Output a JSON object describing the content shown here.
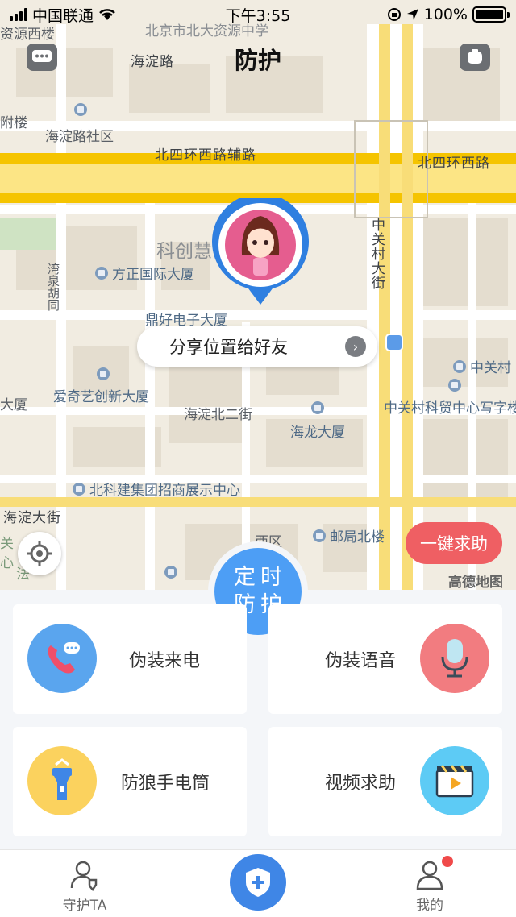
{
  "status_bar": {
    "carrier": "中国联通",
    "time": "下午3:55",
    "battery": "100%"
  },
  "header": {
    "title": "防护"
  },
  "map": {
    "labels": {
      "top_school": "北京市北大资源中学",
      "road_haidian": "海淀路",
      "school_left": "资源西楼",
      "fulou": "附楼",
      "haidian_community": "海淀路社区",
      "beisihuan_fu": "北四环西路辅路",
      "beisihuan": "北四环西路",
      "kechuanghui": "科创慧",
      "zhongguancun_st": "中关村大街",
      "fangzheng": "方正国际大厦",
      "wanquan": "湾泉胡同",
      "dinghao": "鼎好电子大厦",
      "zhongguancun_right": "中关村",
      "daxia_left": "大厦",
      "iqiyi": "爱奇艺创新大厦",
      "zhongguancun_keimao": "中关村科贸中心写字楼",
      "haidian_bei2": "海淀北二街",
      "hailong": "海龙大厦",
      "beike": "北科建集团招商展示中心",
      "haidian_dajie": "海淀大街",
      "xiqu": "西区",
      "youju": "邮局北楼",
      "guan": "关",
      "xin": "心",
      "fa": "法"
    },
    "share_label": "分享位置给好友",
    "sos_label": "一键求助",
    "logo": "高德地图",
    "timer_line1": "定时",
    "timer_line2": "防护"
  },
  "features": [
    {
      "label": "伪装来电",
      "icon": "phone-call-icon",
      "color": "#5aa5ee"
    },
    {
      "label": "伪装语音",
      "icon": "microphone-icon",
      "color": "#f27c80"
    },
    {
      "label": "防狼手电筒",
      "icon": "flashlight-icon",
      "color": "#fbd25e"
    },
    {
      "label": "视频求助",
      "icon": "video-icon",
      "color": "#5dcbf5"
    }
  ],
  "tabbar": {
    "left": "守护TA",
    "right": "我的"
  },
  "colors": {
    "accent": "#3f86e6",
    "sos": "#ef5f63",
    "road": "#f5c400"
  }
}
